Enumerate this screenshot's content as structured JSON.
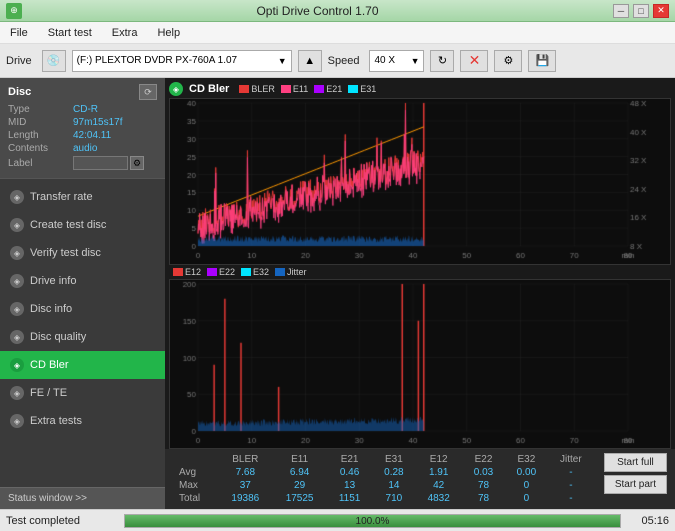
{
  "titlebar": {
    "title": "Opti Drive Control 1.70",
    "icon": "⊕",
    "minimize": "─",
    "maximize": "□",
    "close": "✕"
  },
  "menu": {
    "items": [
      "File",
      "Start test",
      "Extra",
      "Help"
    ]
  },
  "toolbar": {
    "drive_label": "Drive",
    "drive_value": "(F:)  PLEXTOR DVDR  PX-760A 1.07",
    "speed_label": "Speed",
    "speed_value": "40 X"
  },
  "disc": {
    "title": "Disc",
    "type_label": "Type",
    "type_val": "CD-R",
    "mid_label": "MID",
    "mid_val": "97m15s17f",
    "length_label": "Length",
    "length_val": "42:04.11",
    "contents_label": "Contents",
    "contents_val": "audio",
    "label_label": "Label"
  },
  "sidebar_items": [
    {
      "id": "transfer-rate",
      "label": "Transfer rate",
      "active": false
    },
    {
      "id": "create-test-disc",
      "label": "Create test disc",
      "active": false
    },
    {
      "id": "verify-test-disc",
      "label": "Verify test disc",
      "active": false
    },
    {
      "id": "drive-info",
      "label": "Drive info",
      "active": false
    },
    {
      "id": "disc-info",
      "label": "Disc info",
      "active": false
    },
    {
      "id": "disc-quality",
      "label": "Disc quality",
      "active": false
    },
    {
      "id": "cd-bler",
      "label": "CD Bler",
      "active": true
    },
    {
      "id": "fe-te",
      "label": "FE / TE",
      "active": false
    },
    {
      "id": "extra-tests",
      "label": "Extra tests",
      "active": false
    }
  ],
  "status_window_btn": "Status window >>",
  "charts": {
    "top": {
      "title": "CD Bler",
      "legend": [
        {
          "label": "BLER",
          "color": "#e53935"
        },
        {
          "label": "E11",
          "color": "#ff4081"
        },
        {
          "label": "E21",
          "color": "#aa00ff"
        },
        {
          "label": "E31",
          "color": "#00e5ff"
        }
      ],
      "y_max": 40,
      "x_max": 80,
      "right_axis": [
        "48 X",
        "40 X",
        "32 X",
        "24 X",
        "16 X",
        "8 X"
      ]
    },
    "bottom": {
      "legend": [
        {
          "label": "E12",
          "color": "#e53935"
        },
        {
          "label": "E22",
          "color": "#aa00ff"
        },
        {
          "label": "E32",
          "color": "#00e5ff"
        },
        {
          "label": "Jitter",
          "color": "#1565c0"
        }
      ],
      "y_max": 200,
      "x_max": 80
    }
  },
  "stats": {
    "headers": [
      "",
      "BLER",
      "E11",
      "E21",
      "E31",
      "E12",
      "E22",
      "E32",
      "Jitter"
    ],
    "rows": [
      {
        "label": "Avg",
        "vals": [
          "7.68",
          "6.94",
          "0.46",
          "0.28",
          "1.91",
          "0.03",
          "0.00",
          "-"
        ]
      },
      {
        "label": "Max",
        "vals": [
          "37",
          "29",
          "13",
          "14",
          "42",
          "78",
          "0",
          "-"
        ]
      },
      {
        "label": "Total",
        "vals": [
          "19386",
          "17525",
          "1151",
          "710",
          "4832",
          "78",
          "0",
          "-"
        ]
      }
    ]
  },
  "buttons": {
    "start_full": "Start full",
    "start_part": "Start part"
  },
  "bottombar": {
    "status": "Test completed",
    "progress": 100.0,
    "progress_text": "100.0%",
    "time": "05:16"
  }
}
